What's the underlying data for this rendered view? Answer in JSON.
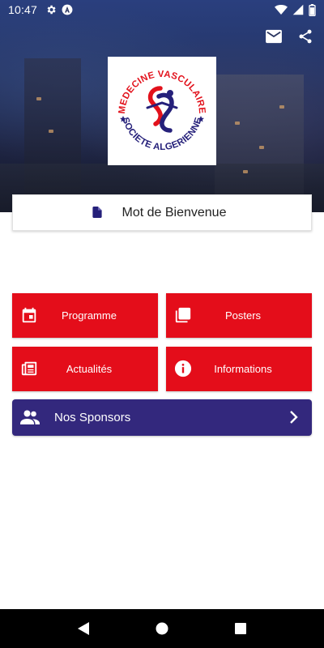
{
  "status_bar": {
    "time": "10:47",
    "left_icons": [
      "gear-icon",
      "vpn-a-icon"
    ],
    "right_icons": [
      "wifi-icon",
      "cellular-icon",
      "battery-icon"
    ]
  },
  "top_actions": {
    "icons": [
      "mail-icon",
      "share-icon"
    ]
  },
  "logo": {
    "line_top": "MEDECINE VASCULAIRE",
    "line_bottom": "SOCIETE ALGERIENNE"
  },
  "welcome": {
    "label": "Mot de Bienvenue",
    "icon": "document-icon"
  },
  "menu": {
    "programme": {
      "label": "Programme",
      "icon": "calendar-icon"
    },
    "posters": {
      "label": "Posters",
      "icon": "stack-icon"
    },
    "actualites": {
      "label": "Actualités",
      "icon": "newspaper-icon"
    },
    "informations": {
      "label": "Informations",
      "icon": "info-icon"
    }
  },
  "sponsors": {
    "label": "Nos Sponsors",
    "icon": "group-icon"
  },
  "colors": {
    "tile_red": "#e40d1a",
    "sponsor_purple": "#33287d",
    "logo_navy": "#25207a",
    "logo_red": "#e2121c"
  }
}
